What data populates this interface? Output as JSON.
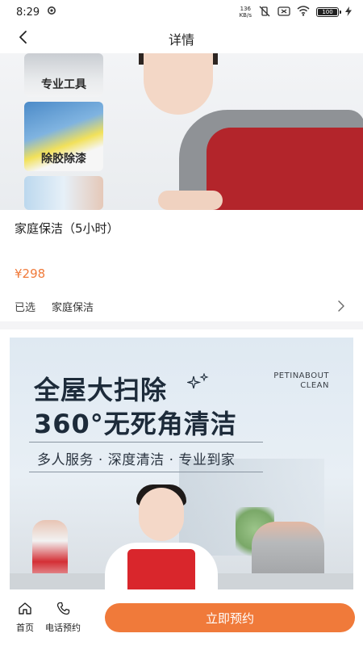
{
  "status_bar": {
    "time": "8:29",
    "net_speed_value": "136",
    "net_speed_unit": "KB/s",
    "battery": "100"
  },
  "nav": {
    "title": "详情",
    "back_icon": "chevron-left-icon"
  },
  "hero": {
    "tile_1": "专业工具",
    "tile_2": "除胶除漆",
    "carousel_active_index": 1,
    "carousel_count": 1
  },
  "product": {
    "title": "家庭保洁（5小时）",
    "price": "¥298",
    "selected_label": "已选",
    "selected_value": "家庭保洁"
  },
  "poster": {
    "headline_1": "全屋大扫除",
    "headline_2": "360°无死角清洁",
    "subline": "多人服务 · 深度清洁 · 专业到家",
    "brand_line_1": "PETINABOUT",
    "brand_line_2": "CLEAN"
  },
  "tab_bar": {
    "home_label": "首页",
    "phone_label": "电话预约",
    "book_label": "立即预约"
  },
  "colors": {
    "accent": "#f07a3a",
    "price": "#f07a3a",
    "divider": "#f4f4f6"
  }
}
